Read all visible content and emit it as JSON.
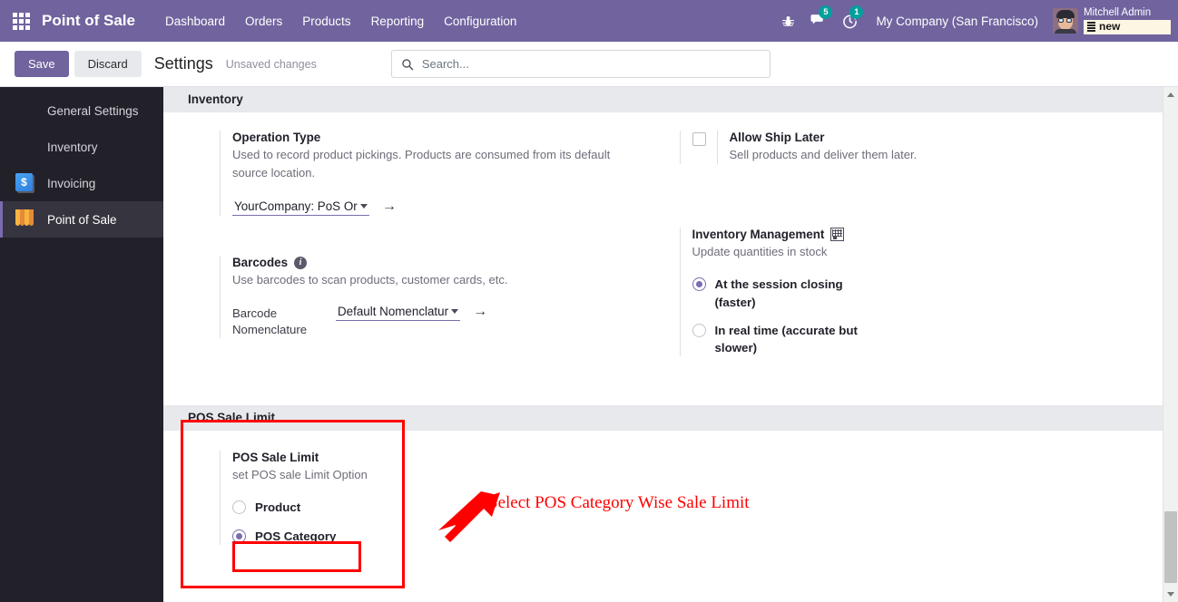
{
  "navbar": {
    "apps_icon": "apps-grid-icon",
    "brand": "Point of Sale",
    "menu": [
      {
        "label": "Dashboard"
      },
      {
        "label": "Orders"
      },
      {
        "label": "Products"
      },
      {
        "label": "Reporting"
      },
      {
        "label": "Configuration"
      }
    ],
    "icons": {
      "debug": "bug-icon",
      "messages": "chat-icon",
      "messages_count": "5",
      "activities": "activity-clock-icon",
      "activities_count": "1"
    },
    "company": "My Company (San Francisco)",
    "user": "Mitchell Admin",
    "database": "new",
    "accent": "#71639e",
    "badge_color": "#00a09d"
  },
  "control_panel": {
    "save_label": "Save",
    "discard_label": "Discard",
    "title": "Settings",
    "status": "Unsaved changes",
    "search_placeholder": "Search..."
  },
  "sidebar": {
    "items": [
      {
        "label": "General Settings",
        "icon": "general-settings-icon",
        "active": false
      },
      {
        "label": "Inventory",
        "icon": "inventory-icon",
        "active": false
      },
      {
        "label": "Invoicing",
        "icon": "invoicing-icon",
        "active": false
      },
      {
        "label": "Point of Sale",
        "icon": "point-of-sale-icon",
        "active": true
      }
    ]
  },
  "inventory_section": {
    "heading": "Inventory",
    "operation_type": {
      "title": "Operation Type",
      "description": "Used to record product pickings. Products are consumed from its default source location.",
      "dropdown_value": "YourCompany: PoS Ord"
    },
    "allow_ship_later": {
      "title": "Allow Ship Later",
      "description": "Sell products and deliver them later.",
      "checked": false
    },
    "barcodes": {
      "title": "Barcodes",
      "description": "Use barcodes to scan products, customer cards, etc.",
      "field_label": "Barcode Nomenclature",
      "dropdown_value": "Default Nomenclatur"
    },
    "inventory_management": {
      "title": "Inventory Management",
      "description": "Update quantities in stock",
      "options": [
        {
          "label": "At the session closing (faster)",
          "selected": true
        },
        {
          "label": "In real time (accurate but slower)",
          "selected": false
        }
      ]
    }
  },
  "pos_sale_limit_section": {
    "heading": "POS Sale Limit",
    "setting": {
      "title": "POS Sale Limit",
      "description": "set POS sale Limit Option",
      "options": [
        {
          "label": "Product",
          "selected": false
        },
        {
          "label": "POS Category",
          "selected": true
        }
      ]
    }
  },
  "annotations": {
    "color": "#ff0000",
    "callout_text": "Select POS Category Wise Sale Limit"
  }
}
